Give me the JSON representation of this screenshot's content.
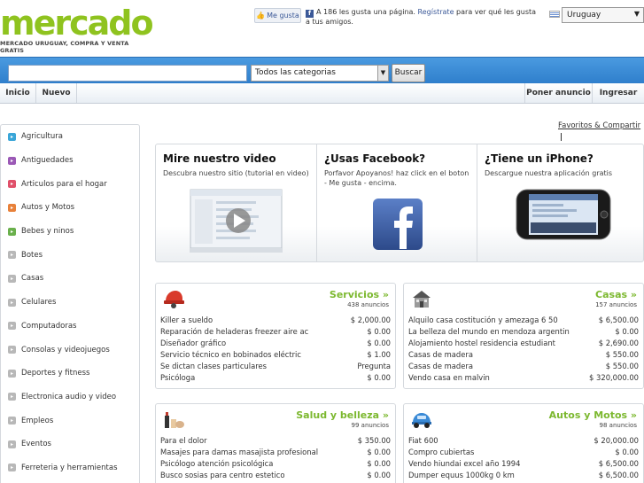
{
  "header": {
    "logo_word": "mercado",
    "logo_tagline": "MERCADO URUGUAY, COMPRA Y VENTA GRATIS",
    "fb_like_label": "Me gusta",
    "fb_line_prefix": "A 186 les gusta una página.",
    "fb_line_link": "Regístrate",
    "fb_line_suffix": "para ver qué les gusta a tus amigos.",
    "country": "Uruguay"
  },
  "search": {
    "value": "",
    "category": "Todos las categorias",
    "button": "Buscar"
  },
  "nav": {
    "inicio": "Inicio",
    "nuevo": "Nuevo",
    "poner_anuncio": "Poner anuncio",
    "ingresar": "Ingresar"
  },
  "favoritos": "Favoritos & Compartir",
  "sidebar": {
    "items": [
      {
        "label": "Agricultura",
        "color": "#3aa6d8"
      },
      {
        "label": "Antiguedades",
        "color": "#9b59b6"
      },
      {
        "label": "Articulos para el hogar",
        "color": "#e0506a"
      },
      {
        "label": "Autos y Motos",
        "color": "#e8813a"
      },
      {
        "label": "Bebes y ninos",
        "color": "#6ab04c"
      },
      {
        "label": "Botes",
        "color": "#b8b8b8"
      },
      {
        "label": "Casas",
        "color": "#b8b8b8"
      },
      {
        "label": "Celulares",
        "color": "#b8b8b8"
      },
      {
        "label": "Computadoras",
        "color": "#b8b8b8"
      },
      {
        "label": "Consolas y videojuegos",
        "color": "#b8b8b8"
      },
      {
        "label": "Deportes y fitness",
        "color": "#b8b8b8"
      },
      {
        "label": "Electronica audio y video",
        "color": "#b8b8b8"
      },
      {
        "label": "Empleos",
        "color": "#b8b8b8"
      },
      {
        "label": "Eventos",
        "color": "#b8b8b8"
      },
      {
        "label": "Ferreteria y herramientas",
        "color": "#b8b8b8"
      }
    ]
  },
  "promo": [
    {
      "title": "Mire nuestro video",
      "subtitle": "Descubra nuestro sitio (tutorial en video)"
    },
    {
      "title": "¿Usas Facebook?",
      "subtitle": "Porfavor Apoyanos! haz click en el boton - Me gusta - encima."
    },
    {
      "title": "¿Tiene un iPhone?",
      "subtitle": "Descargue nuestra aplicación gratis"
    }
  ],
  "boxes": {
    "servicios": {
      "title": "Servicios »",
      "count": "438 anuncios",
      "rows": [
        {
          "title": "Killer a sueldo",
          "price": "$ 2,000.00"
        },
        {
          "title": "Reparación de heladeras freezer aire ac",
          "price": "$ 0.00"
        },
        {
          "title": "Diseñador gráfico",
          "price": "$ 0.00"
        },
        {
          "title": "Servicio técnico en bobinados eléctric",
          "price": "$ 1.00"
        },
        {
          "title": "Se dictan clases particulares",
          "price": "Pregunta"
        },
        {
          "title": "Psicóloga",
          "price": "$ 0.00"
        }
      ]
    },
    "casas": {
      "title": "Casas »",
      "count": "157 anuncios",
      "rows": [
        {
          "title": "Alquilo casa costitución y amezaga 6 50",
          "price": "$ 6,500.00"
        },
        {
          "title": "La belleza del mundo en mendoza argentin",
          "price": "$ 0.00"
        },
        {
          "title": "Alojamiento hostel residencia estudiant",
          "price": "$ 2,690.00"
        },
        {
          "title": "Casas de madera",
          "price": "$ 550.00"
        },
        {
          "title": "Casas de madera",
          "price": "$ 550.00"
        },
        {
          "title": "Vendo casa en malvin",
          "price": "$ 320,000.00"
        }
      ]
    },
    "salud": {
      "title": "Salud y belleza »",
      "count": "99 anuncios",
      "rows": [
        {
          "title": "Para el dolor",
          "price": "$ 350.00"
        },
        {
          "title": "Masajes para damas masajista profesional",
          "price": "$ 0.00"
        },
        {
          "title": "Psicólogo atención psicológica",
          "price": "$ 0.00"
        },
        {
          "title": "Busco sosias para centro estetico",
          "price": "$ 0.00"
        }
      ]
    },
    "autos": {
      "title": "Autos y Motos »",
      "count": "98 anuncios",
      "rows": [
        {
          "title": "Fiat 600",
          "price": "$ 20,000.00"
        },
        {
          "title": "Compro cubiertas",
          "price": "$ 0.00"
        },
        {
          "title": "Vendo hiundai excel año 1994",
          "price": "$ 6,500.00"
        },
        {
          "title": "Dumper equus 1000kg 0 km",
          "price": "$ 6,500.00"
        }
      ]
    }
  }
}
